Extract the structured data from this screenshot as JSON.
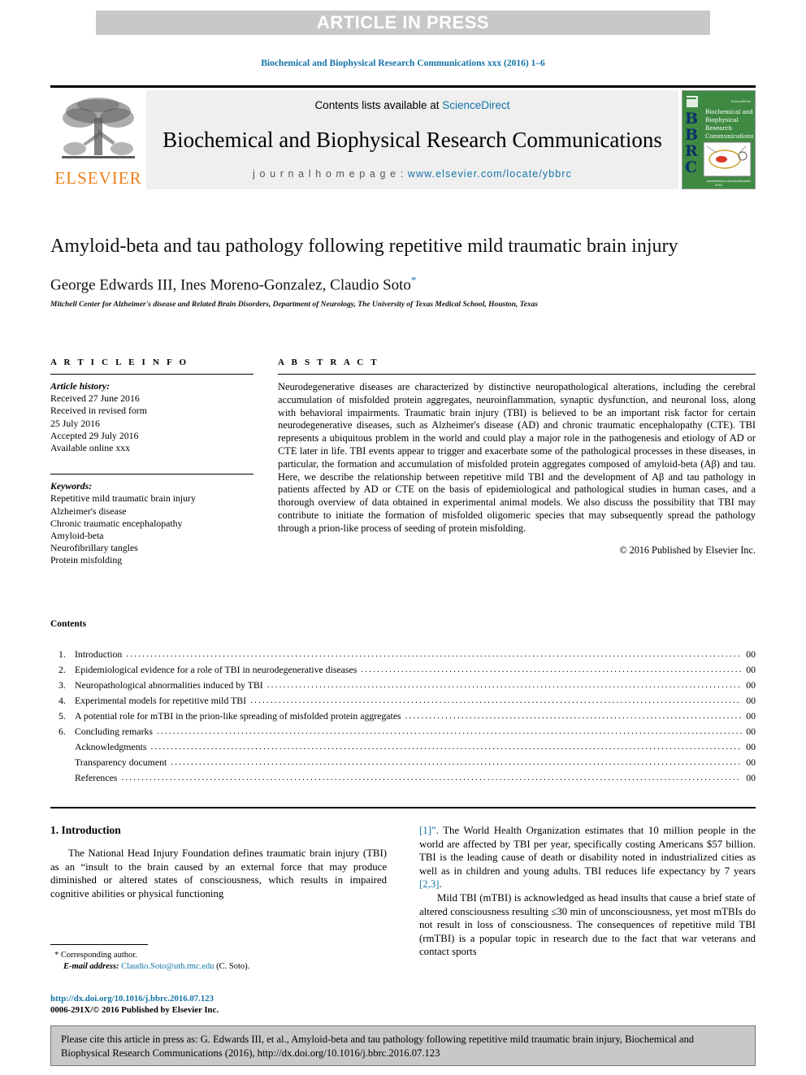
{
  "banner": {
    "text": "ARTICLE IN PRESS"
  },
  "running_head": "Biochemical and Biophysical Research Communications xxx (2016) 1–6",
  "masthead": {
    "publisher": "ELSEVIER",
    "contents_prefix": "Contents lists available at ",
    "contents_link": "ScienceDirect",
    "journal_title": "Biochemical and Biophysical Research Communications",
    "homepage_prefix": "j o u r n a l   h o m e p a g e :  ",
    "homepage_url": "www.elsevier.com/locate/ybbrc",
    "cover": {
      "letters": "BBRC",
      "title_lines": [
        "Biochemical and",
        "Biophysical",
        "Research",
        "Communications"
      ]
    }
  },
  "article": {
    "title": "Amyloid-beta and tau pathology following repetitive mild traumatic brain injury",
    "authors": "George Edwards III, Ines Moreno-Gonzalez, Claudio Soto",
    "corresponding_marker": "*",
    "affiliation": "Mitchell Center for Alzheimer's disease and Related Brain Disorders, Department of Neurology, The University of Texas Medical School, Houston, Texas"
  },
  "article_info": {
    "heading": "A R T I C L E  I N F O",
    "history_label": "Article history:",
    "history": [
      "Received 27 June 2016",
      "Received in revised form",
      "25 July 2016",
      "Accepted 29 July 2016",
      "Available online xxx"
    ],
    "keywords_label": "Keywords:",
    "keywords": [
      "Repetitive mild traumatic brain injury",
      "Alzheimer's disease",
      "Chronic traumatic encephalopathy",
      "Amyloid-beta",
      "Neurofibrillary tangles",
      "Protein misfolding"
    ]
  },
  "abstract": {
    "heading": "A B S T R A C T",
    "text": "Neurodegenerative diseases are characterized by distinctive neuropathological alterations, including the cerebral accumulation of misfolded protein aggregates, neuroinflammation, synaptic dysfunction, and neuronal loss, along with behavioral impairments. Traumatic brain injury (TBI) is believed to be an important risk factor for certain neurodegenerative diseases, such as Alzheimer's disease (AD) and chronic traumatic encephalopathy (CTE). TBI represents a ubiquitous problem in the world and could play a major role in the pathogenesis and etiology of AD or CTE later in life. TBI events appear to trigger and exacerbate some of the pathological processes in these diseases, in particular, the formation and accumulation of misfolded protein aggregates composed of amyloid-beta (Aβ) and tau. Here, we describe the relationship between repetitive mild TBI and the development of Aβ and tau pathology in patients affected by AD or CTE on the basis of epidemiological and pathological studies in human cases, and a thorough overview of data obtained in experimental animal models. We also discuss the possibility that TBI may contribute to initiate the formation of misfolded oligomeric species that may subsequently spread the pathology through a prion-like process of seeding of protein misfolding.",
    "copyright": "© 2016 Published by Elsevier Inc."
  },
  "contents": {
    "label": "Contents",
    "items": [
      {
        "num": "1.",
        "label": "Introduction",
        "page": "00"
      },
      {
        "num": "2.",
        "label": "Epidemiological evidence for a role of TBI in neurodegenerative diseases",
        "page": "00"
      },
      {
        "num": "3.",
        "label": "Neuropathological abnormalities induced by TBI",
        "page": "00"
      },
      {
        "num": "4.",
        "label": "Experimental models for repetitive mild TBI",
        "page": "00"
      },
      {
        "num": "5.",
        "label": "A potential role for mTBI in the prion-like spreading of misfolded protein aggregates",
        "page": "00"
      },
      {
        "num": "6.",
        "label": "Concluding remarks",
        "page": "00"
      },
      {
        "num": "",
        "label": "Acknowledgments",
        "page": "00"
      },
      {
        "num": "",
        "label": "Transparency document",
        "page": "00"
      },
      {
        "num": "",
        "label": "References",
        "page": "00"
      }
    ]
  },
  "body": {
    "section_number_title": "1.  Introduction",
    "left_para_1": "The National Head Injury Foundation defines traumatic brain injury (TBI) as an “insult to the brain caused by an external force that may produce diminished or altered states of consciousness, which results in impaired cognitive abilities or physical functioning",
    "right_para_1_ref": "[1]”",
    "right_para_1_rest": ". The World Health Organization estimates that 10 million people in the world are affected by TBI per year, specifically costing Americans $57 billion. TBI is the leading cause of death or disability noted in industrialized cities as well as in children and young adults. TBI reduces life expectancy by 7 years ",
    "right_para_1_ref2": "[2,3]",
    "right_para_1_end": ".",
    "right_para_2": "Mild TBI (mTBI) is acknowledged as head insults that cause a brief state of altered consciousness resulting ≤30 min of unconsciousness, yet most mTBIs do not result in loss of consciousness. The consequences of repetitive mild TBI (rmTBI) is a popular topic in research due to the fact that war veterans and contact sports"
  },
  "footnote": {
    "marker": "*",
    "corresponding": "Corresponding author.",
    "email_label": "E-mail address:",
    "email": "Claudio.Soto@uth.tmc.edu",
    "email_suffix": "(C. Soto)."
  },
  "doi_block": {
    "doi": "http://dx.doi.org/10.1016/j.bbrc.2016.07.123",
    "issn_line": "0006-291X/© 2016 Published by Elsevier Inc."
  },
  "cite_box": {
    "text": "Please cite this article in press as: G. Edwards III, et al., Amyloid-beta and tau pathology following repetitive mild traumatic brain injury, Biochemical and Biophysical Research Communications (2016), http://dx.doi.org/10.1016/j.bbrc.2016.07.123"
  },
  "colors": {
    "link": "#1273a8",
    "banner_bg": "#c8c8c8",
    "masthead_bg": "#efefef",
    "elsevier_orange": "#ef7f1a",
    "cover_green": "#3f8a42"
  }
}
